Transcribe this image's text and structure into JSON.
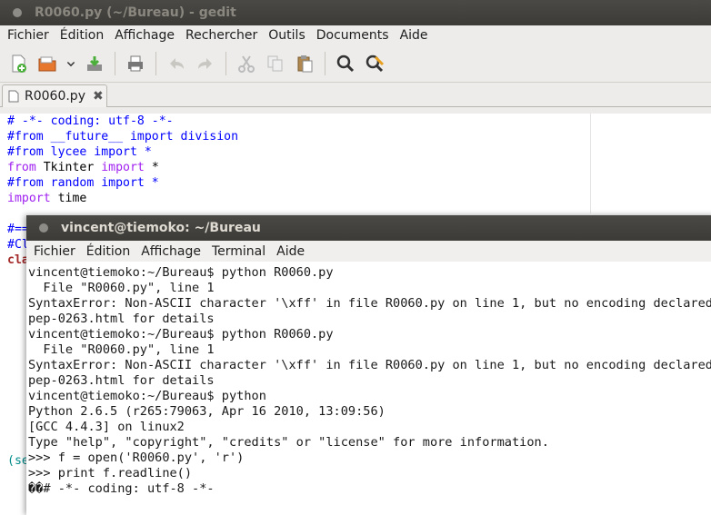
{
  "gedit": {
    "title": "R0060.py (~/Bureau) - gedit",
    "menu": [
      "Fichier",
      "Édition",
      "Affichage",
      "Rechercher",
      "Outils",
      "Documents",
      "Aide"
    ],
    "toolbar_icons": [
      "new-document-icon",
      "open-folder-icon",
      "dropdown-arrow-icon",
      "save-icon",
      "print-icon",
      "undo-icon",
      "redo-icon",
      "cut-icon",
      "copy-icon",
      "paste-icon",
      "find-icon",
      "find-replace-icon"
    ],
    "tab": {
      "label": "R0060.py",
      "close": "✖"
    },
    "code": {
      "l1": "# -*- coding: utf-8 -*-",
      "l2": "#from __future__ import division",
      "l3": "#from lycee import *",
      "l4_from": "from",
      "l4_mod": " Tkinter ",
      "l4_import": "import",
      "l4_star": " *",
      "l5": "#from random import *",
      "l6_import": "import",
      "l6_mod": " time",
      "l7": "#==",
      "l8": "#Cl",
      "l9": "cla",
      "l10": "(se"
    }
  },
  "terminal": {
    "title": "vincent@tiemoko: ~/Bureau",
    "menu": [
      "Fichier",
      "Édition",
      "Affichage",
      "Terminal",
      "Aide"
    ],
    "lines": [
      "vincent@tiemoko:~/Bureau$ python R0060.py",
      "  File \"R0060.py\", line 1",
      "SyntaxError: Non-ASCII character '\\xff' in file R0060.py on line 1, but no encoding declared;",
      "pep-0263.html for details",
      "vincent@tiemoko:~/Bureau$ python R0060.py",
      "  File \"R0060.py\", line 1",
      "SyntaxError: Non-ASCII character '\\xff' in file R0060.py on line 1, but no encoding declared;",
      "pep-0263.html for details",
      "vincent@tiemoko:~/Bureau$ python",
      "Python 2.6.5 (r265:79063, Apr 16 2010, 13:09:56)",
      "[GCC 4.4.3] on linux2",
      "Type \"help\", \"copyright\", \"credits\" or \"license\" for more information.",
      ">>> f = open('R0060.py', 'r')",
      ">>> print f.readline()",
      "��# -*- coding: utf-8 -*-"
    ]
  }
}
